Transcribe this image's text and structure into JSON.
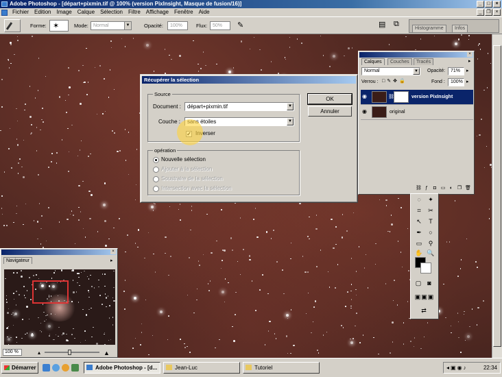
{
  "window": {
    "title": "Adobe Photoshop - [départ+pixmin.tif @ 100% (version PixInsight, Masque de fusion/16)]"
  },
  "menu": [
    "Fichier",
    "Edition",
    "Image",
    "Calque",
    "Sélection",
    "Filtre",
    "Affichage",
    "Fenêtre",
    "Aide"
  ],
  "options_bar": {
    "forme_label": "Forme:",
    "mode_label": "Mode:",
    "mode_value": "Normal",
    "opacite_label": "Opacité:",
    "opacite_value": "100%",
    "flux_label": "Flux:",
    "flux_value": "50%",
    "well_tabs": [
      "Histogramme",
      "Infos"
    ]
  },
  "dialog": {
    "title": "Récupérer la sélection",
    "source_group": "Source",
    "document_label": "Document :",
    "document_value": "départ+pixmin.tif",
    "couche_label": "Couche :",
    "couche_value": "sans étoiles",
    "inverser_label": "Inverser",
    "inverser_checked": true,
    "operation_group": "opération",
    "operations": [
      {
        "label": "Nouvelle sélection",
        "selected": true,
        "enabled": true
      },
      {
        "label": "Ajouter à la sélection",
        "selected": false,
        "enabled": false
      },
      {
        "label": "Soustraire de la sélection",
        "selected": false,
        "enabled": false
      },
      {
        "label": "Intersection avec la sélection",
        "selected": false,
        "enabled": false
      }
    ],
    "ok_label": "OK",
    "cancel_label": "Annuler"
  },
  "layers_palette": {
    "tabs": [
      "Calques",
      "Couches",
      "Tracés"
    ],
    "blend_mode": "Normal",
    "opacity_label": "Opacité:",
    "opacity_value": "71%",
    "lock_label": "Verrou :",
    "fill_label": "Fond :",
    "fill_value": "100%",
    "layers": [
      {
        "name": "version PixInsight",
        "selected": true,
        "has_mask": true
      },
      {
        "name": "original",
        "selected": false,
        "has_mask": false
      }
    ]
  },
  "navigator": {
    "title": "Navigateur",
    "zoom": "100 %"
  },
  "taskbar": {
    "start_label": "Démarrer",
    "tasks": [
      {
        "label": "Adobe Photoshop - [d...",
        "active": true
      },
      {
        "label": "Jean-Luc",
        "active": false
      },
      {
        "label": "Tutoriel",
        "active": false
      }
    ],
    "clock": "22:34"
  },
  "colors": {
    "title_bar": "#0a246a",
    "chrome": "#d4d0c8",
    "canvas_base": "#4a2620",
    "cursor_highlight": "#ffd43c",
    "navigator_view_rect": "#dd3333"
  }
}
